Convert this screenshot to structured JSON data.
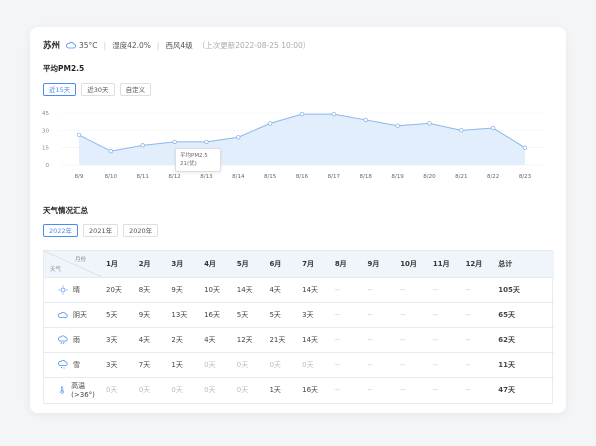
{
  "header": {
    "city": "苏州",
    "temperature": "35°C",
    "humidity": "湿度42.0%",
    "wind": "西风4级",
    "updated": "（上次更新2022-08-25 10:00）"
  },
  "pm_section": {
    "title": "平均PM2.5",
    "ranges": [
      "近15天",
      "近30天",
      "自定义"
    ],
    "active_range": 0
  },
  "tooltip": {
    "title": "平均PM2.5",
    "value": "21(优)"
  },
  "chart_data": {
    "type": "area",
    "x": [
      "8/9",
      "8/10",
      "8/11",
      "8/12",
      "8/13",
      "8/14",
      "8/15",
      "8/16",
      "8/17",
      "8/18",
      "8/19",
      "8/20",
      "8/21",
      "8/22",
      "8/23"
    ],
    "values": [
      26,
      12,
      17,
      20,
      20,
      24,
      36,
      44,
      44,
      39,
      34,
      36,
      30,
      32,
      15
    ],
    "yticks": [
      0,
      15,
      30,
      45
    ],
    "ylim": [
      0,
      45
    ],
    "grid": true,
    "color": "#8ab6ec",
    "fill": "#e3eefc"
  },
  "summary": {
    "title": "天气情况汇总",
    "years": [
      "2022年",
      "2021年",
      "2020年"
    ],
    "active_year": 0,
    "header_month": "月份",
    "header_weather": "天气",
    "months": [
      "1月",
      "2月",
      "3月",
      "4月",
      "5月",
      "6月",
      "7月",
      "8月",
      "9月",
      "10月",
      "11月",
      "12月"
    ],
    "total_label": "总计",
    "rows": [
      {
        "icon": "sun-icon",
        "name": "晴",
        "values": [
          "20天",
          "8天",
          "9天",
          "10天",
          "14天",
          "4天",
          "14天",
          "--",
          "--",
          "--",
          "--",
          "--"
        ],
        "total": "105天"
      },
      {
        "icon": "cloudy-icon",
        "name": "阴天",
        "values": [
          "5天",
          "9天",
          "13天",
          "16天",
          "5天",
          "5天",
          "3天",
          "--",
          "--",
          "--",
          "--",
          "--"
        ],
        "total": "65天"
      },
      {
        "icon": "rain-icon",
        "name": "雨",
        "values": [
          "3天",
          "4天",
          "2天",
          "4天",
          "12天",
          "21天",
          "14天",
          "--",
          "--",
          "--",
          "--",
          "--"
        ],
        "total": "62天"
      },
      {
        "icon": "snow-icon",
        "name": "雪",
        "values": [
          "3天",
          "7天",
          "1天",
          "0天",
          "0天",
          "0天",
          "0天",
          "--",
          "--",
          "--",
          "--",
          "--"
        ],
        "total": "11天"
      },
      {
        "icon": "thermometer-icon",
        "name": "高温(>36°)",
        "values": [
          "0天",
          "0天",
          "0天",
          "0天",
          "0天",
          "1天",
          "16天",
          "--",
          "--",
          "--",
          "--",
          "--"
        ],
        "total": "47天"
      }
    ]
  }
}
